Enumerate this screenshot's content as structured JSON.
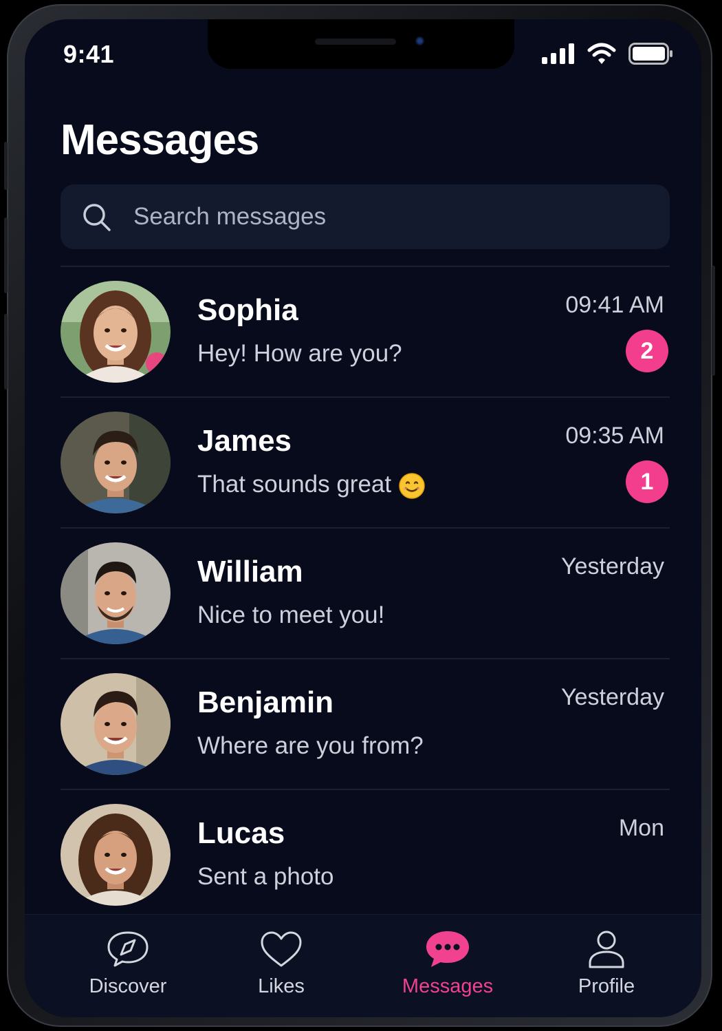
{
  "status_bar": {
    "time": "9:41"
  },
  "header": {
    "title": "Messages"
  },
  "search": {
    "placeholder": "Search messages"
  },
  "conversations": [
    {
      "name": "Sophia",
      "preview": "Hey! How are you?",
      "time": "09:41 AM",
      "unread": "2"
    },
    {
      "name": "James",
      "preview": "That sounds great",
      "time": "09:35 AM",
      "unread": "1"
    },
    {
      "name": "William",
      "preview": "Nice to meet you!",
      "time": "Yesterday"
    },
    {
      "name": "Benjamin",
      "preview": "Where are you from?",
      "time": "Yesterday"
    },
    {
      "name": "Lucas",
      "preview": "Sent a photo",
      "time": "Mon"
    }
  ],
  "tabs": [
    {
      "label": "Discover",
      "icon": "compass-chat-icon"
    },
    {
      "label": "Likes",
      "icon": "heart-icon"
    },
    {
      "label": "Messages",
      "icon": "chat-bubble-icon",
      "active": true
    },
    {
      "label": "Profile",
      "icon": "person-icon"
    }
  ],
  "colors": {
    "background": "#070b1c",
    "accent": "#f23e8c",
    "search_bg": "#141a2e"
  }
}
